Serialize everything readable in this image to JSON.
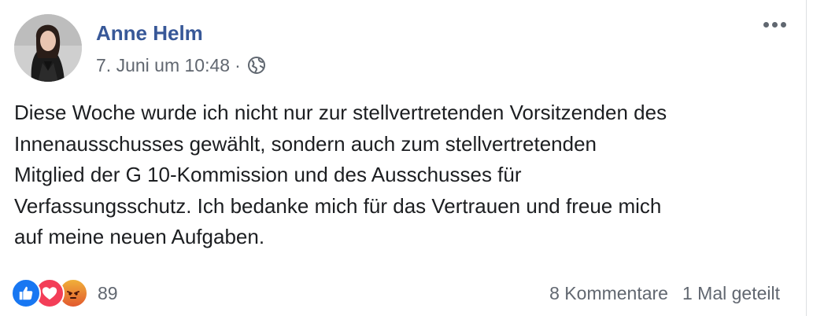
{
  "post": {
    "author": "Anne Helm",
    "timestamp": "7. Juni um 10:48",
    "separator": "·",
    "audience_icon": "globe-icon",
    "menu_icon": "more-options-icon",
    "text_lines": [
      "Diese Woche wurde ich nicht nur zur stellvertretenden Vorsitzenden des",
      "Innenausschusses gewählt, sondern auch zum stellvertretenden",
      "Mitglied der G 10-Kommission und des Ausschusses für",
      "Verfassungsschutz. Ich bedanke mich für das Vertrauen und freue mich",
      "auf meine neuen Aufgaben."
    ]
  },
  "reactions": {
    "icons": [
      "like-icon",
      "love-icon",
      "angry-icon"
    ],
    "count": "89"
  },
  "stats": {
    "comments": "8 Kommentare",
    "shares": "1 Mal geteilt"
  },
  "colors": {
    "author_link": "#385898",
    "meta_text": "#616770",
    "body_text": "#1c1e21",
    "like": "#1877f2",
    "love": "#f33e58",
    "angry": "#e9711c"
  }
}
